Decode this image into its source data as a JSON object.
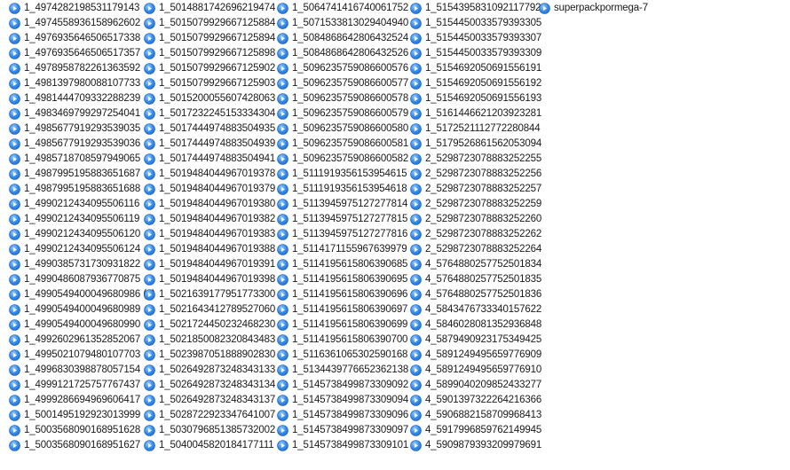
{
  "icon": {
    "name": "quicktime-file-icon",
    "color_outer": "#1f6fd6",
    "color_inner": "#9fd1ff"
  },
  "columns": [
    [
      "1_4974282198531179143",
      "1_4974558936158962602",
      "1_4976935646506517338",
      "1_4976935646506517357",
      "1_4978958782261363592",
      "1_4981397980088107733",
      "1_4981444709332288239",
      "1_4983469799297254041",
      "1_4985677919293539035",
      "1_4985677919293539036",
      "1_4985718708597949065",
      "1_4987995195883651687",
      "1_4987995195883651688",
      "1_4990212434095506116",
      "1_4990212434095506119",
      "1_4990212434095506120",
      "1_4990212434095506124",
      "1_4990385731730931822",
      "1_4990486087936770875",
      "1_4990549400049680986 (1)",
      "1_4990549400049680989",
      "1_4990549400049680990",
      "1_4992602961352852067",
      "1_4995021079480107703",
      "1_4996830398878057154",
      "1_4999121725757767437",
      "1_4999286694969606417",
      "1_5001495192923013999",
      "1_5003568090168951628",
      "1_5003568090168951627"
    ],
    [
      "1_5014881742696219474",
      "1_5015079929667125884",
      "1_5015079929667125894",
      "1_5015079929667125898",
      "1_5015079929667125902",
      "1_5015079929667125903",
      "1_5015200055607428063",
      "1_5017232245153334304",
      "1_5017444974883504935",
      "1_5017444974883504939",
      "1_5017444974883504941",
      "1_5019484044967019378",
      "1_5019484044967019379",
      "1_5019484044967019380",
      "1_5019484044967019382",
      "1_5019484044967019383",
      "1_5019484044967019388",
      "1_5019484044967019391",
      "1_5019484044967019398",
      "1_5021639177951773300",
      "1_5021643412789527060",
      "1_5021724450232468230",
      "1_5021850082320843483",
      "1_5023987051888902830",
      "1_5026492873248343133",
      "1_5026492873248343134",
      "1_5026492873248343137",
      "1_5028722923347641007",
      "1_5030796851385732002",
      "1_5040045820184177111"
    ],
    [
      "1_5064741416740061752",
      "1_5071533813029404940",
      "1_5084868642806432524",
      "1_5084868642806432526",
      "1_5096235759086600576",
      "1_5096235759086600577",
      "1_5096235759086600578",
      "1_5096235759086600579",
      "1_5096235759086600580",
      "1_5096235759086600581",
      "1_5096235759086600582",
      "1_5111919356153954615",
      "1_5111919356153954618",
      "1_5113945975127277814",
      "1_5113945975127277815",
      "1_5113945975127277816",
      "1_5114171155967639979",
      "1_5114195615806390685",
      "1_5114195615806390695",
      "1_5114195615806390696",
      "1_5114195615806390697",
      "1_5114195615806390699",
      "1_5114195615806390700",
      "1_5116361065302590168",
      "1_5134439776652362138",
      "1_5145738499873309092",
      "1_5145738499873309094",
      "1_5145738499873309096",
      "1_5145738499873309097",
      "1_5145738499873309101"
    ],
    [
      "1_5154395831092117792",
      "1_5154450033579393305",
      "1_5154450033579393307",
      "1_5154450033579393309",
      "1_5154692050691556191",
      "1_5154692050691556192",
      "1_5154692050691556193",
      "1_5161446621203923281",
      "1_5172521112772280844",
      "1_5179526861562053094",
      "2_5298723078883252255",
      "2_5298723078883252256",
      "2_5298723078883252257",
      "2_5298723078883252259",
      "2_5298723078883252260",
      "2_5298723078883252262",
      "2_5298723078883252264",
      "4_5764880257752501834",
      "4_5764880257752501835",
      "4_5764880257752501836",
      "4_5843476733340157622",
      "4_5846028081352936848",
      "4_5879490923175349425",
      "4_5891249495659776909",
      "4_5891249495659776910",
      "4_5899040209852433277",
      "4_5901397322264216366",
      "4_5906882158709968413",
      "4_5917996859762149945",
      "4_5909879393209979691"
    ],
    [
      "superpackpormega-7"
    ]
  ]
}
